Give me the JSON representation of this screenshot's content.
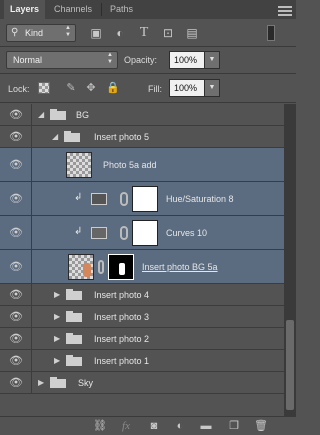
{
  "tabs": [
    {
      "label": "Layers"
    },
    {
      "label": "Channels"
    },
    {
      "label": "Paths"
    }
  ],
  "filter": {
    "kind_label": "Kind",
    "icons": [
      "image-filter-icon",
      "adjustment-filter-icon",
      "type-filter-icon",
      "shape-filter-icon",
      "smart-object-filter-icon"
    ]
  },
  "blend": {
    "mode": "Normal",
    "opacity_label": "Opacity:",
    "opacity_value": "100%"
  },
  "lock": {
    "label": "Lock:",
    "fill_label": "Fill:",
    "fill_value": "100%"
  },
  "layers": [
    {
      "name": "BG",
      "type": "group",
      "expanded": true,
      "level": 0
    },
    {
      "name": "Insert photo 5",
      "type": "group",
      "expanded": true,
      "level": 1
    },
    {
      "name": "Photo 5a add",
      "type": "pixel",
      "selected": true
    },
    {
      "name": "Hue/Saturation 8",
      "type": "adjustment",
      "selected": true
    },
    {
      "name": "Curves 10",
      "type": "adjustment",
      "selected": true
    },
    {
      "name": "Insert photo BG 5a",
      "type": "masked",
      "selected": true
    },
    {
      "name": "Insert photo 4",
      "type": "group",
      "expanded": false,
      "level": 1
    },
    {
      "name": "Insert photo 3",
      "type": "group",
      "expanded": false,
      "level": 1
    },
    {
      "name": "Insert photo 2",
      "type": "group",
      "expanded": false,
      "level": 1
    },
    {
      "name": "Insert photo 1",
      "type": "group",
      "expanded": false,
      "level": 1
    },
    {
      "name": "Sky",
      "type": "group",
      "expanded": false,
      "level": 0
    }
  ],
  "colors": {
    "panel_bg": "#535353",
    "selected_row": "#5b6b80",
    "tab_bar": "#424242"
  },
  "bottom_icons": [
    "link-layers-icon",
    "fx-icon",
    "add-mask-icon",
    "adjustment-layer-icon",
    "new-group-icon",
    "new-layer-icon",
    "delete-layer-icon"
  ]
}
